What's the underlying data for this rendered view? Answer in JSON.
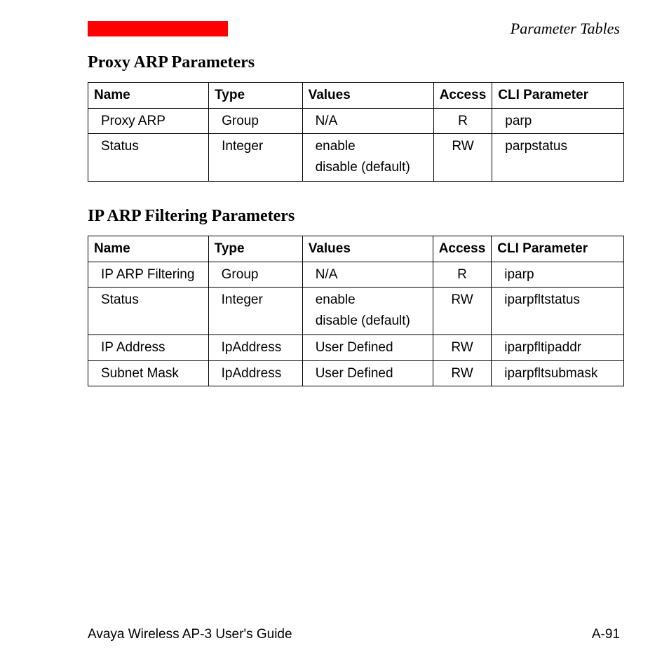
{
  "header": {
    "title": "Parameter Tables"
  },
  "sections": {
    "proxy": {
      "heading": "Proxy ARP Parameters",
      "columns": {
        "name": "Name",
        "type": "Type",
        "values": "Values",
        "access": "Access",
        "cli": "CLI Parameter"
      },
      "rows": [
        {
          "name": "Proxy ARP",
          "type": "Group",
          "values": [
            "N/A"
          ],
          "access": "R",
          "cli": "parp"
        },
        {
          "name": "Status",
          "type": "Integer",
          "values": [
            "enable",
            "disable (default)"
          ],
          "access": "RW",
          "cli": "parpstatus"
        }
      ]
    },
    "iparp": {
      "heading": "IP ARP Filtering Parameters",
      "columns": {
        "name": "Name",
        "type": "Type",
        "values": "Values",
        "access": "Access",
        "cli": "CLI Parameter"
      },
      "rows": [
        {
          "name": "IP ARP Filtering",
          "type": "Group",
          "values": [
            "N/A"
          ],
          "access": "R",
          "cli": "iparp"
        },
        {
          "name": "Status",
          "type": "Integer",
          "values": [
            "enable",
            "disable (default)"
          ],
          "access": "RW",
          "cli": "iparpfltstatus"
        },
        {
          "name": "IP Address",
          "type": "IpAddress",
          "values": [
            "User Defined"
          ],
          "access": "RW",
          "cli": "iparpfltipaddr"
        },
        {
          "name": "Subnet Mask",
          "type": "IpAddress",
          "values": [
            "User Defined"
          ],
          "access": "RW",
          "cli": "iparpfltsubmask"
        }
      ]
    }
  },
  "footer": {
    "left": "Avaya Wireless AP-3 User's Guide",
    "right": "A-91"
  }
}
